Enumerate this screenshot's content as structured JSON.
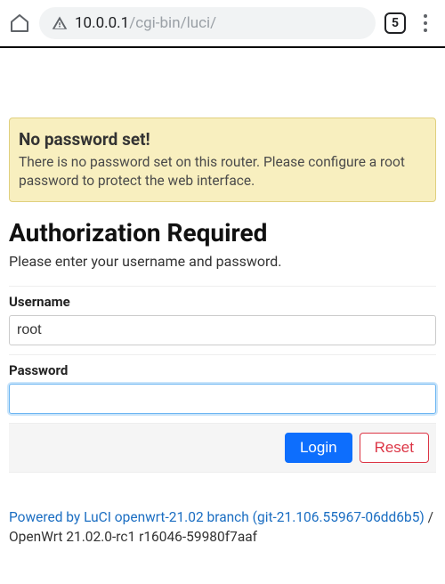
{
  "browser": {
    "tab_count": "5",
    "url_host": "10.0.0.1",
    "url_path": "/cgi-bin/luci/"
  },
  "alert": {
    "title": "No password set!",
    "body": "There is no password set on this router. Please configure a root password to protect the web interface."
  },
  "auth": {
    "heading": "Authorization Required",
    "subheading": "Please enter your username and password.",
    "username_label": "Username",
    "username_value": "root",
    "password_label": "Password",
    "password_value": "",
    "login_label": "Login",
    "reset_label": "Reset"
  },
  "footer": {
    "link_text": "Powered by LuCI openwrt-21.02 branch (git-21.106.55967-06dd6b5)",
    "separator": " / ",
    "version": "OpenWrt 21.02.0-rc1 r16046-59980f7aaf"
  }
}
